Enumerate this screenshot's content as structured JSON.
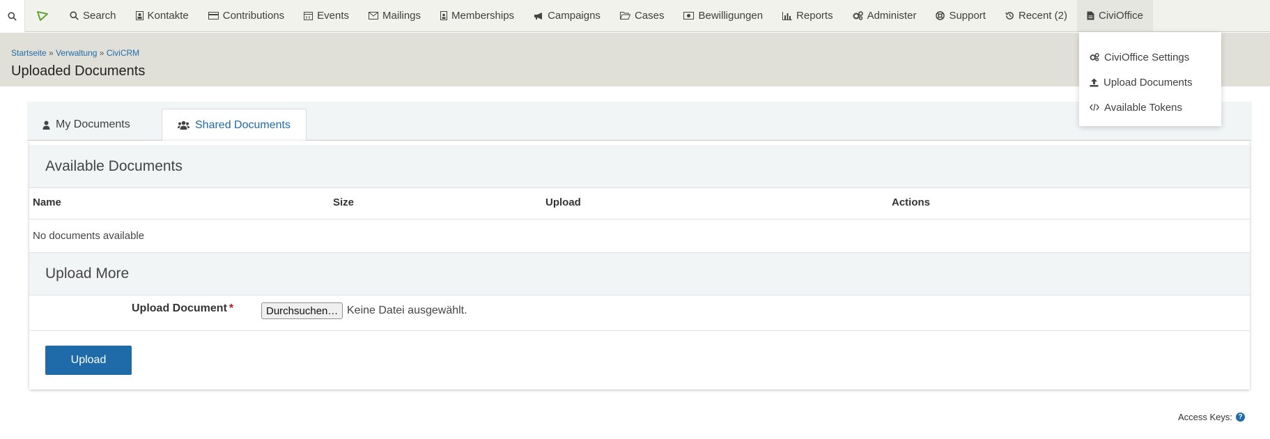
{
  "nav": {
    "items": [
      {
        "label": "Search",
        "icon": "search-icon"
      },
      {
        "label": "Kontakte",
        "icon": "contact-card-icon"
      },
      {
        "label": "Contributions",
        "icon": "credit-card-icon"
      },
      {
        "label": "Events",
        "icon": "calendar-icon"
      },
      {
        "label": "Mailings",
        "icon": "envelope-icon"
      },
      {
        "label": "Memberships",
        "icon": "id-badge-icon"
      },
      {
        "label": "Campaigns",
        "icon": "bullhorn-icon"
      },
      {
        "label": "Cases",
        "icon": "folder-open-icon"
      },
      {
        "label": "Bewilligungen",
        "icon": "money-icon"
      },
      {
        "label": "Reports",
        "icon": "bar-chart-icon"
      },
      {
        "label": "Administer",
        "icon": "gears-icon"
      },
      {
        "label": "Support",
        "icon": "life-ring-icon"
      },
      {
        "label": "Recent (2)",
        "icon": "history-icon"
      },
      {
        "label": "CiviOffice",
        "icon": "file-icon"
      }
    ]
  },
  "dropdown": {
    "items": [
      {
        "label": "CiviOffice Settings",
        "icon": "gears-icon"
      },
      {
        "label": "Upload Documents",
        "icon": "upload-icon"
      },
      {
        "label": "Available Tokens",
        "icon": "code-icon"
      }
    ]
  },
  "breadcrumb": {
    "items": [
      "Startseite",
      "Verwaltung",
      "CiviCRM"
    ],
    "separator": "»"
  },
  "page": {
    "title": "Uploaded Documents"
  },
  "tabs": [
    {
      "label": "My Documents",
      "icon": "user-icon"
    },
    {
      "label": "Shared Documents",
      "icon": "users-icon"
    }
  ],
  "available": {
    "heading": "Available Documents",
    "columns": [
      "Name",
      "Size",
      "Upload",
      "Actions"
    ],
    "empty_message": "No documents available"
  },
  "upload": {
    "heading": "Upload More",
    "label": "Upload Document",
    "required_mark": "*",
    "browse_label": "Durchsuchen…",
    "no_file_text": "Keine Datei ausgewählt.",
    "submit_label": "Upload"
  },
  "footer": {
    "access_keys": "Access Keys:",
    "help_glyph": "?"
  },
  "colors": {
    "accent": "#1f6aa8",
    "required": "#c0161b"
  }
}
